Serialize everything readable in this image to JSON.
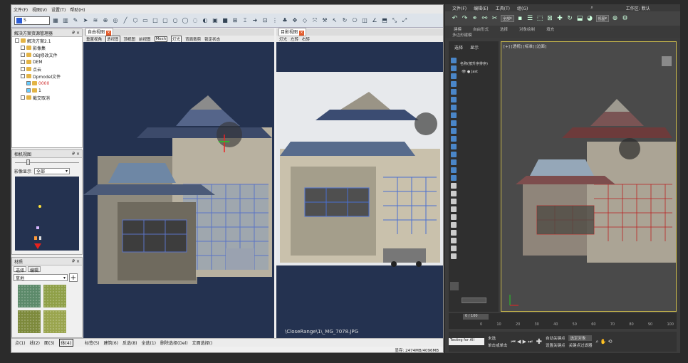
{
  "left_app": {
    "menu": [
      "文件(F)",
      "视图(V)",
      "设置(T)",
      "帮助(H)"
    ],
    "toolbar_combo": "S",
    "project_panel": {
      "title": "解决方案资源管理器",
      "items": [
        {
          "label": "解决方案2.1",
          "indent": 0
        },
        {
          "label": "影像集",
          "indent": 1
        },
        {
          "label": "OBJ修改文件",
          "indent": 1
        },
        {
          "label": "DEM",
          "indent": 1
        },
        {
          "label": "点云",
          "indent": 1
        },
        {
          "label": "Dpmodel文件",
          "indent": 1
        },
        {
          "label": "0000",
          "indent": 2,
          "highlight": true
        },
        {
          "label": "1",
          "indent": 2
        },
        {
          "label": "截交取消",
          "indent": 1
        }
      ]
    },
    "camera_panel": {
      "title": "相机视图",
      "label": "影像显示",
      "combo": "全部"
    },
    "material_panel": {
      "title": "材质",
      "tabs": [
        "选择",
        "编辑"
      ],
      "combo": "草地",
      "swatch_colors": [
        "#5c8a6a",
        "#8fa048",
        "#7d8a3c",
        "#9aa54e"
      ]
    },
    "viewport1": {
      "tab": "自由视图",
      "bar": [
        "重置视角",
        "透视图",
        "顶视图",
        "前视图",
        "Mesh",
        "灯光",
        "背面裁剪",
        "锁定状态"
      ]
    },
    "viewport2": {
      "tab": "目影视图",
      "bar": [
        "灯光",
        "左转",
        "右转"
      ],
      "filename": "\\CloseRange\\1\\_MG_7078.JPG"
    },
    "statusbar": [
      "点(1)",
      "线(2)",
      "面(3)",
      "体(4)",
      "标签(5)",
      "建筑(6)",
      "反选(8)",
      "全选(1)",
      "删除选择(Del)",
      "立面选择()"
    ],
    "memory": "显存: 2474MB/4096MB"
  },
  "right_app": {
    "menu": [
      "文件(F)",
      "编辑(E)",
      "工具(T)",
      "组(G)"
    ],
    "search_combo": "全部",
    "workspace_label": "工作区: 默认",
    "view_combo": "视图",
    "ribbon_tabs": [
      "建模",
      "自由形式",
      "选择",
      "对象绘制",
      "填充"
    ],
    "ribbon_sub": "多边形建模",
    "scene_tabs": [
      "选择",
      "显示"
    ],
    "viewport_label": "[+] [透视] [标准] [边面]",
    "scene_tree_header": "名称(按升序排序)",
    "scene_item": "Jast",
    "frame_counter": "0 / 100",
    "ruler": [
      "0",
      "10",
      "20",
      "30",
      "40",
      "50",
      "60",
      "70",
      "80",
      "90",
      "100"
    ],
    "script_box": "Testing for All",
    "status_text": "未选",
    "status_text2": "单击或单击",
    "auto_key": "自动关键点",
    "set_key": "设置关键点",
    "selected_combo": "选定对象",
    "key_filter": "关键点过滤器"
  }
}
